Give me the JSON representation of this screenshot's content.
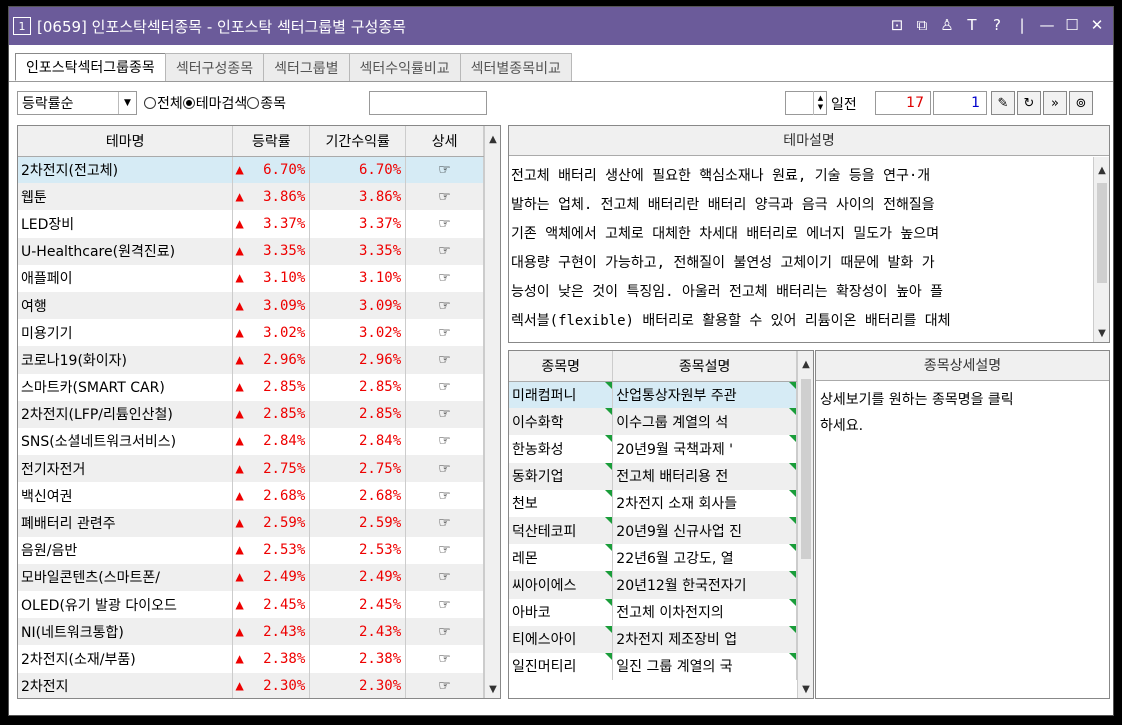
{
  "window": {
    "number": "1",
    "title": "[0659] 인포스탁섹터종목 - 인포스탁 섹터그룹별 구성종목"
  },
  "tabs": [
    "인포스탁섹터그룹종목",
    "섹터구성종목",
    "섹터그룹별",
    "섹터수익률비교",
    "섹터별종목비교"
  ],
  "toolbar": {
    "sort_value": "등락률순",
    "radio_all": "전체",
    "radio_theme": "테마검색",
    "radio_stock": "종목",
    "search_value": "",
    "days_label": "일전",
    "days_value": "",
    "page_total": "17",
    "page_current": "1"
  },
  "theme_table": {
    "headers": [
      "테마명",
      "등락률",
      "기간수익률",
      "상세"
    ],
    "rows": [
      {
        "name": "2차전지(전고체)",
        "rate": "6.70%",
        "period": "6.70%"
      },
      {
        "name": "웹툰",
        "rate": "3.86%",
        "period": "3.86%"
      },
      {
        "name": "LED장비",
        "rate": "3.37%",
        "period": "3.37%"
      },
      {
        "name": "U-Healthcare(원격진료)",
        "rate": "3.35%",
        "period": "3.35%"
      },
      {
        "name": "애플페이",
        "rate": "3.10%",
        "period": "3.10%"
      },
      {
        "name": "여행",
        "rate": "3.09%",
        "period": "3.09%"
      },
      {
        "name": "미용기기",
        "rate": "3.02%",
        "period": "3.02%"
      },
      {
        "name": "코로나19(화이자)",
        "rate": "2.96%",
        "period": "2.96%"
      },
      {
        "name": "스마트카(SMART CAR)",
        "rate": "2.85%",
        "period": "2.85%"
      },
      {
        "name": "2차전지(LFP/리튬인산철)",
        "rate": "2.85%",
        "period": "2.85%"
      },
      {
        "name": "SNS(소셜네트워크서비스)",
        "rate": "2.84%",
        "period": "2.84%"
      },
      {
        "name": "전기자전거",
        "rate": "2.75%",
        "period": "2.75%"
      },
      {
        "name": "백신여권",
        "rate": "2.68%",
        "period": "2.68%"
      },
      {
        "name": "폐배터리 관련주",
        "rate": "2.59%",
        "period": "2.59%"
      },
      {
        "name": "음원/음반",
        "rate": "2.53%",
        "period": "2.53%"
      },
      {
        "name": "모바일콘텐츠(스마트폰/",
        "rate": "2.49%",
        "period": "2.49%"
      },
      {
        "name": "OLED(유기 발광 다이오드",
        "rate": "2.45%",
        "period": "2.45%"
      },
      {
        "name": "NI(네트워크통합)",
        "rate": "2.43%",
        "period": "2.43%"
      },
      {
        "name": "2차전지(소재/부품)",
        "rate": "2.38%",
        "period": "2.38%"
      },
      {
        "name": "2차전지",
        "rate": "2.30%",
        "period": "2.30%"
      }
    ]
  },
  "theme_desc": {
    "header": "테마설명",
    "lines": [
      "전고체 배터리 생산에 필요한 핵심소재나 원료, 기술 등을 연구·개",
      "발하는 업체. 전고체 배터리란 배터리 양극과 음극 사이의 전해질을",
      "기존 액체에서 고체로 대체한 차세대 배터리로 에너지 밀도가 높으며",
      "대용량 구현이 가능하고, 전해질이 불연성 고체이기 때문에 발화 가",
      "능성이 낮은 것이 특징임. 아울러 전고체 배터리는 확장성이 높아 플",
      "렉서블(flexible) 배터리로 활용할 수 있어 리튬이온 배터리를 대체"
    ]
  },
  "stock_table": {
    "headers": [
      "종목명",
      "종목설명"
    ],
    "rows": [
      {
        "name": "미래컴퍼니",
        "desc": "산업통상자원부 주관"
      },
      {
        "name": "이수화학",
        "desc": "이수그룹 계열의 석"
      },
      {
        "name": "한농화성",
        "desc": "20년9월 국책과제 '"
      },
      {
        "name": "동화기업",
        "desc": "전고체 배터리용 전"
      },
      {
        "name": "천보",
        "desc": "2차전지 소재 회사들"
      },
      {
        "name": "덕산테코피",
        "desc": "20년9월 신규사업 진"
      },
      {
        "name": "레몬",
        "desc": "22년6월 고강도, 열"
      },
      {
        "name": "씨아이에스",
        "desc": "20년12월 한국전자기"
      },
      {
        "name": "아바코",
        "desc": "전고체 이차전지의"
      },
      {
        "name": "티에스아이",
        "desc": "2차전지 제조장비 업"
      },
      {
        "name": "일진머티리",
        "desc": "일진 그룹 계열의 국"
      }
    ]
  },
  "stock_detail": {
    "header": "종목상세설명",
    "text_line1": "상세보기를 원하는 종목명을 클릭",
    "text_line2": "하세요."
  },
  "colors": {
    "titlebar": "#6b5b9a",
    "up": "#e00000",
    "selected_row": "#d6ebf5",
    "marker": "#1a9d3a"
  }
}
